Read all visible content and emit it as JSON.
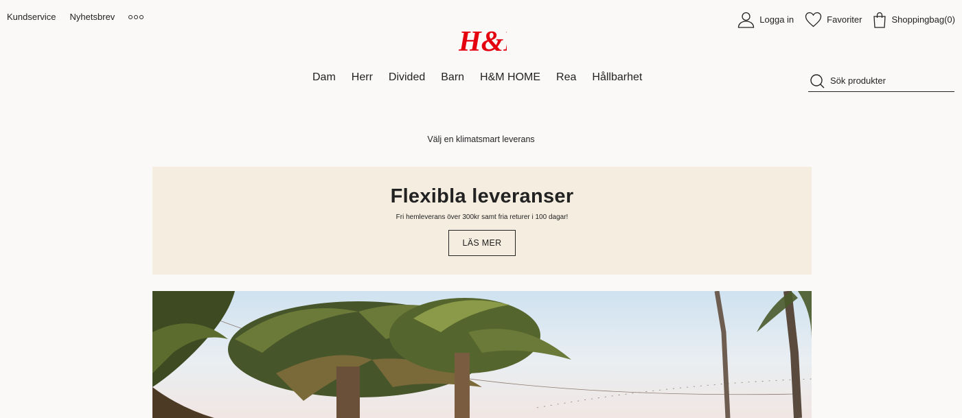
{
  "utility_nav": {
    "customer_service": "Kundservice",
    "newsletter": "Nyhetsbrev",
    "more": "more-dots-icon"
  },
  "brand": {
    "logo_text": "H&M",
    "logo_color": "#e50010"
  },
  "account": {
    "login": "Logga in",
    "favorites": "Favoriter",
    "bag": "Shoppingbag(0)"
  },
  "main_nav": [
    "Dam",
    "Herr",
    "Divided",
    "Barn",
    "H&M HOME",
    "Rea",
    "Hållbarhet"
  ],
  "search": {
    "placeholder": "Sök produkter"
  },
  "climate_text": "Välj en klimatsmart leverans",
  "promo": {
    "title": "Flexibla leveranser",
    "subtitle": "Fri hemleverans över 300kr samt fria returer i 100 dagar!",
    "button": "LÄS MER",
    "background": "#f4ede0"
  },
  "hero": {
    "description_icon": "palm-trees-image"
  }
}
